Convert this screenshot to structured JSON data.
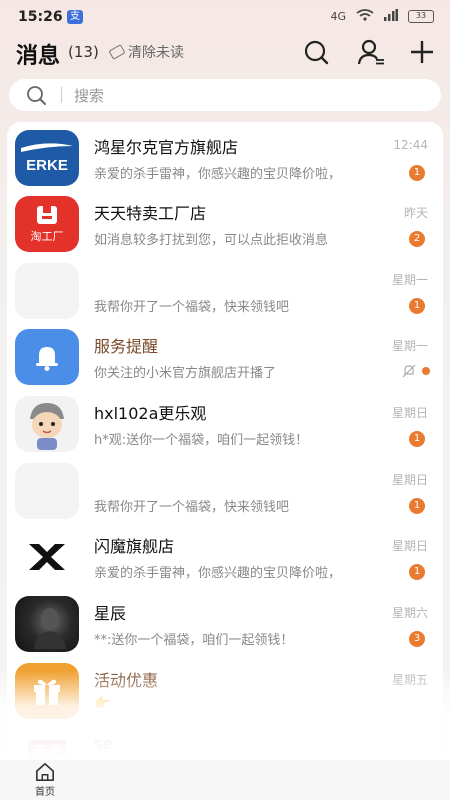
{
  "status_bar": {
    "time": "15:26",
    "app_icon_text": "支",
    "network": "4G",
    "battery": "33"
  },
  "header": {
    "title": "消息",
    "count": "(13)",
    "clear_unread": "清除未读"
  },
  "search": {
    "placeholder": "搜索"
  },
  "conversations": [
    {
      "name": "鸿星尔克官方旗舰店",
      "preview": "亲爱的杀手雷神，你感兴趣的宝贝降价啦，",
      "time": "12:44",
      "badge": "1",
      "avatar": "erke-logo"
    },
    {
      "name": "天天特卖工厂店",
      "preview": "如消息较多打扰到您，可以点此拒收消息",
      "time": "昨天",
      "badge": "2",
      "avatar": "taogongchang-logo",
      "avatar_text": "淘工厂"
    },
    {
      "name": "",
      "preview": "我帮你开了一个福袋，快来领钱吧",
      "time": "星期一",
      "badge": "1",
      "avatar": "blank"
    },
    {
      "name": "服务提醒",
      "preview": "你关注的小米官方旗舰店开播了",
      "time": "星期一",
      "badge": "",
      "avatar": "bell-icon",
      "muted": true
    },
    {
      "name": "hxl102a更乐观",
      "preview": "h*观:送你一个福袋，咱们一起领钱！",
      "time": "星期日",
      "badge": "1",
      "avatar": "cartoon-avatar"
    },
    {
      "name": "",
      "preview": "我帮你开了一个福袋，快来领钱吧",
      "time": "星期日",
      "badge": "1",
      "avatar": "blank"
    },
    {
      "name": "闪魔旗舰店",
      "preview": "亲爱的杀手雷神，你感兴趣的宝贝降价啦，",
      "time": "星期日",
      "badge": "1",
      "avatar": "shanmo-logo"
    },
    {
      "name": "星辰",
      "preview": "**:送你一个福袋，咱们一起领钱！",
      "time": "星期六",
      "badge": "3",
      "avatar": "photo-avatar"
    },
    {
      "name": "活动优惠",
      "preview": "👉",
      "time": "星期五",
      "badge": "",
      "avatar": "gift-icon"
    },
    {
      "name": "se",
      "preview": "",
      "time": "",
      "badge": "",
      "avatar": "xibei-logo",
      "avatar_text": "西麦"
    }
  ],
  "tabbar": {
    "home_label": "首页"
  },
  "colors": {
    "badge": "#e87b30",
    "service_name": "#7a4a2a",
    "erke_blue": "#1f5aa6",
    "taogongchang_red": "#e2322a",
    "bell_blue": "#4a8ee8",
    "gift_orange": "#f0a030"
  }
}
